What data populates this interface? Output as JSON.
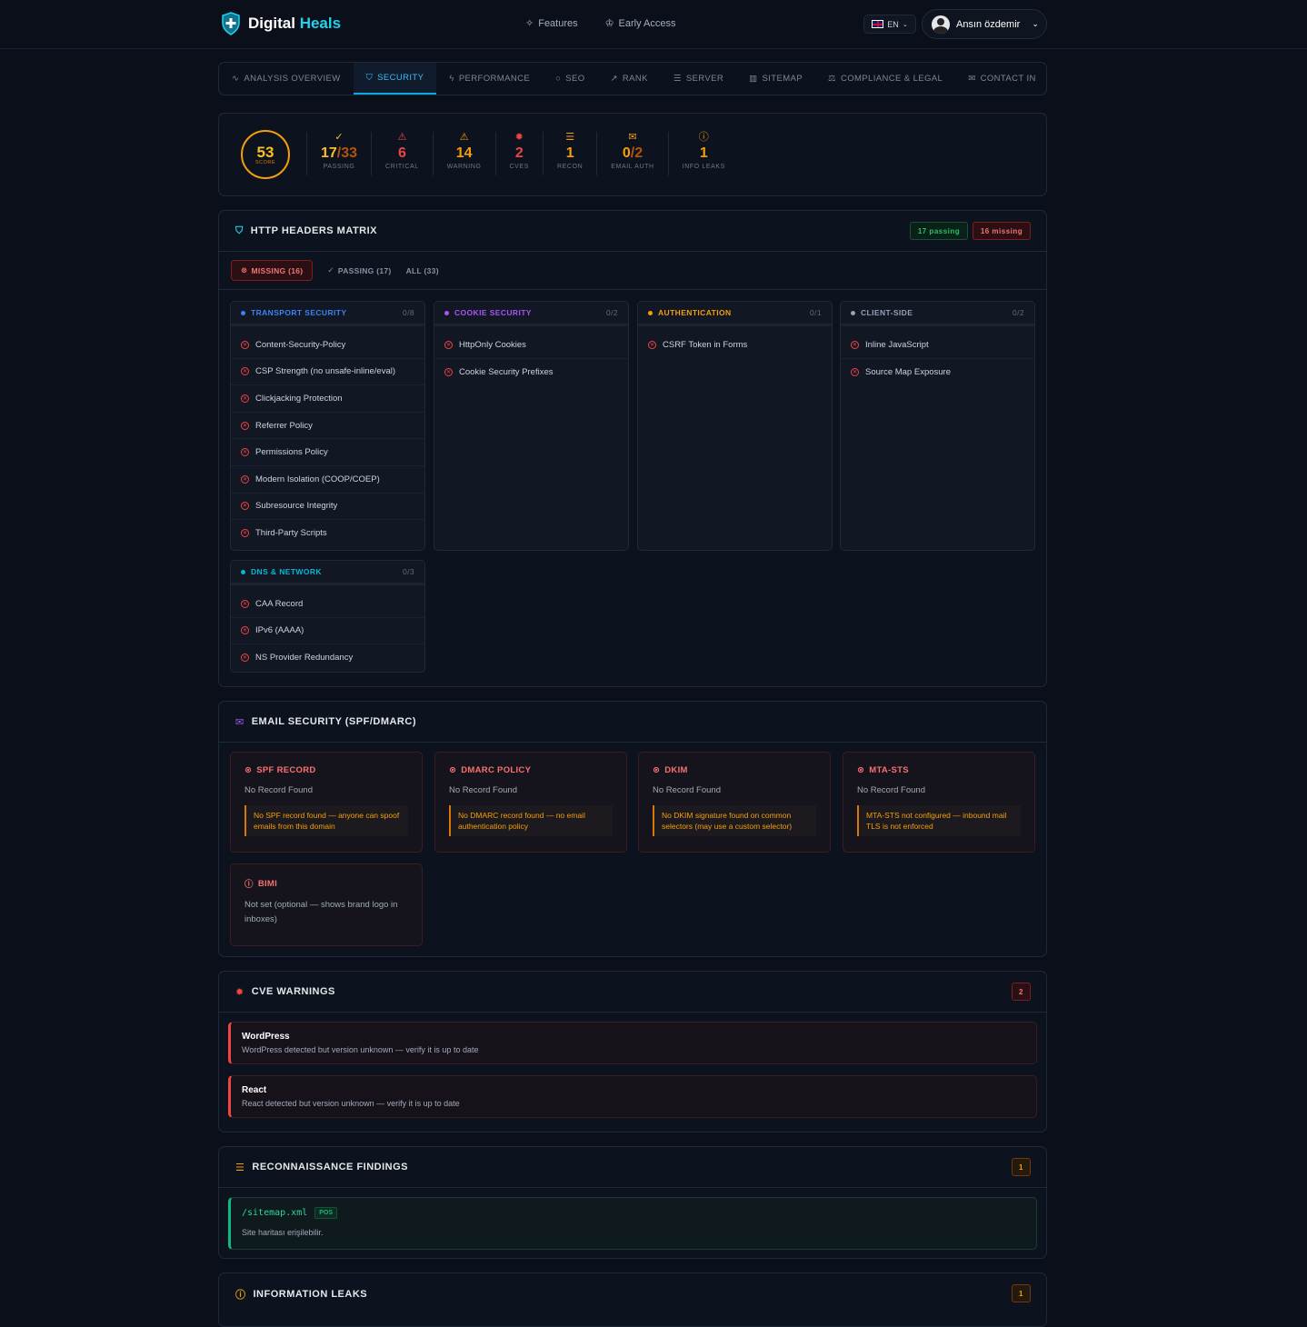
{
  "header": {
    "brand_a": "Digital",
    "brand_b": "Heals",
    "nav": [
      {
        "label": "Features",
        "icon": "sparkles-icon"
      },
      {
        "label": "Early Access",
        "icon": "crown-icon"
      }
    ],
    "lang": "EN",
    "user": "Ansın özdemir"
  },
  "tabs": [
    {
      "label": "ANALYSIS OVERVIEW",
      "icon": "activity-icon"
    },
    {
      "label": "SECURITY",
      "icon": "shield-icon"
    },
    {
      "label": "PERFORMANCE",
      "icon": "bolt-icon"
    },
    {
      "label": "SEO",
      "icon": "search-icon"
    },
    {
      "label": "RANK",
      "icon": "trend-icon"
    },
    {
      "label": "SERVER",
      "icon": "server-icon"
    },
    {
      "label": "SITEMAP",
      "icon": "map-icon"
    },
    {
      "label": "COMPLIANCE & LEGAL",
      "icon": "scale-icon"
    },
    {
      "label": "CONTACT IN",
      "icon": "mail-icon"
    }
  ],
  "score": {
    "value": "53",
    "label": "SCORE",
    "stats": [
      {
        "val": "17",
        "suffix": "/33",
        "label": "PASSING",
        "color": "#fbbf24",
        "icon": "✓"
      },
      {
        "val": "6",
        "suffix": "",
        "label": "CRITICAL",
        "color": "#ef4444",
        "icon": "⚠"
      },
      {
        "val": "14",
        "suffix": "",
        "label": "WARNING",
        "color": "#f59e0b",
        "icon": "⚠"
      },
      {
        "val": "2",
        "suffix": "",
        "label": "CVES",
        "color": "#ef4444",
        "icon": "✹"
      },
      {
        "val": "1",
        "suffix": "",
        "label": "RECON",
        "color": "#f59e0b",
        "icon": "☰"
      },
      {
        "val": "0",
        "suffix": "/2",
        "label": "EMAIL AUTH",
        "color": "#f59e0b",
        "icon": "✉"
      },
      {
        "val": "1",
        "suffix": "",
        "label": "INFO LEAKS",
        "color": "#f59e0b",
        "icon": "ⓘ"
      }
    ]
  },
  "headers": {
    "title": "HTTP HEADERS MATRIX",
    "passing_badge": "17 passing",
    "missing_badge": "16 missing",
    "filters": {
      "missing": "MISSING (16)",
      "passing": "PASSING (17)",
      "all": "ALL (33)"
    },
    "groups": [
      {
        "title": "TRANSPORT SECURITY",
        "count": "0/8",
        "color": "#3b82f6",
        "items": [
          "Content-Security-Policy",
          "CSP Strength (no unsafe-inline/eval)",
          "Clickjacking Protection",
          "Referrer Policy",
          "Permissions Policy",
          "Modern Isolation (COOP/COEP)",
          "Subresource Integrity",
          "Third-Party Scripts"
        ]
      },
      {
        "title": "COOKIE SECURITY",
        "count": "0/2",
        "color": "#a855f7",
        "items": [
          "HttpOnly Cookies",
          "Cookie Security Prefixes"
        ]
      },
      {
        "title": "AUTHENTICATION",
        "count": "0/1",
        "color": "#f59e0b",
        "items": [
          "CSRF Token in Forms"
        ]
      },
      {
        "title": "CLIENT-SIDE",
        "count": "0/2",
        "color": "#94a3b8",
        "items": [
          "Inline JavaScript",
          "Source Map Exposure"
        ]
      },
      {
        "title": "DNS & NETWORK",
        "count": "0/3",
        "color": "#06b6d4",
        "items": [
          "CAA Record",
          "IPv6 (AAAA)",
          "NS Provider Redundancy"
        ]
      }
    ]
  },
  "email": {
    "title": "EMAIL SECURITY (SPF/DMARC)",
    "records": [
      {
        "title": "SPF RECORD",
        "status": "No Record Found",
        "warn": "No SPF record found — anyone can spoof emails from this domain"
      },
      {
        "title": "DMARC POLICY",
        "status": "No Record Found",
        "warn": "No DMARC record found — no email authentication policy"
      },
      {
        "title": "DKIM",
        "status": "No Record Found",
        "warn": "No DKIM signature found on common selectors (may use a custom selector)"
      },
      {
        "title": "MTA-STS",
        "status": "No Record Found",
        "warn": "MTA-STS not configured — inbound mail TLS is not enforced"
      },
      {
        "title": "BIMI",
        "status": "Not set (optional — shows brand logo in inboxes)",
        "warn": ""
      }
    ]
  },
  "cve": {
    "title": "CVE WARNINGS",
    "count": "2",
    "items": [
      {
        "title": "WordPress",
        "desc": "WordPress detected but version unknown — verify it is up to date"
      },
      {
        "title": "React",
        "desc": "React detected but version unknown — verify it is up to date"
      }
    ]
  },
  "recon": {
    "title": "RECONNAISSANCE FINDINGS",
    "count": "1",
    "path": "/sitemap.xml",
    "tag": "POS",
    "desc": "Site haritası erişilebilir."
  },
  "leaks": {
    "title": "INFORMATION LEAKS",
    "count": "1"
  }
}
